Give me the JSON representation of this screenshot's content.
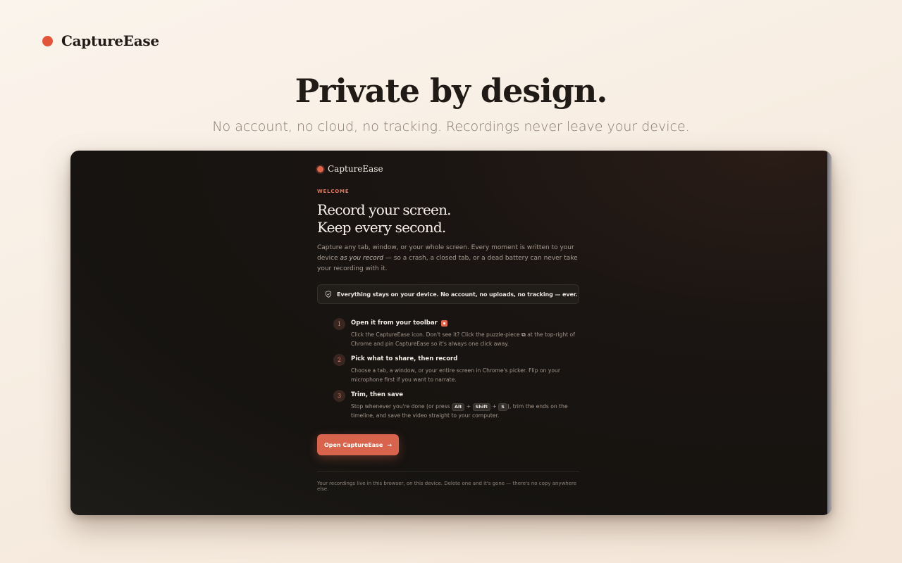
{
  "brand": {
    "name": "CaptureEase",
    "dot_color": "#e2553a"
  },
  "hero": {
    "title": "Private by design.",
    "subtitle": "No account, no cloud, no tracking. Recordings never leave your device."
  },
  "app": {
    "brand_name": "CaptureEase",
    "eyebrow": "WELCOME",
    "headline_line1": "Record your screen.",
    "headline_line2": "Keep every second.",
    "intro_part1": "Capture any tab, window, or your whole screen. Every moment is written to your device ",
    "intro_em": "as you record",
    "intro_part2": " — so a crash, a closed tab, or a dead battery can never take your recording with it.",
    "notice": "Everything stays on your device. No account, no uploads, no tracking — ever.",
    "steps": [
      {
        "num": "1",
        "title": "Open it from your toolbar",
        "desc_part1": "Click the CaptureEase icon. Don't see it? Click the puzzle-piece ",
        "desc_part2": " at the top-right of Chrome and pin CaptureEase so it's always one click away."
      },
      {
        "num": "2",
        "title": "Pick what to share, then record",
        "desc": "Choose a tab, a window, or your entire screen in Chrome's picker. Flip on your microphone first if you want to narrate."
      },
      {
        "num": "3",
        "title": "Trim, then save",
        "desc_part1": "Stop whenever you're done (or press ",
        "keys": [
          "Alt",
          "Shift",
          "S"
        ],
        "key_sep": "+",
        "desc_part2": "), trim the ends on the timeline, and save the video straight to your computer."
      }
    ],
    "cta_label": "Open CaptureEase",
    "cta_arrow": "→",
    "footer": "Your recordings live in this browser, on this device. Delete one and it's gone — there's no copy anywhere else.",
    "accent_color": "#d8644d"
  }
}
